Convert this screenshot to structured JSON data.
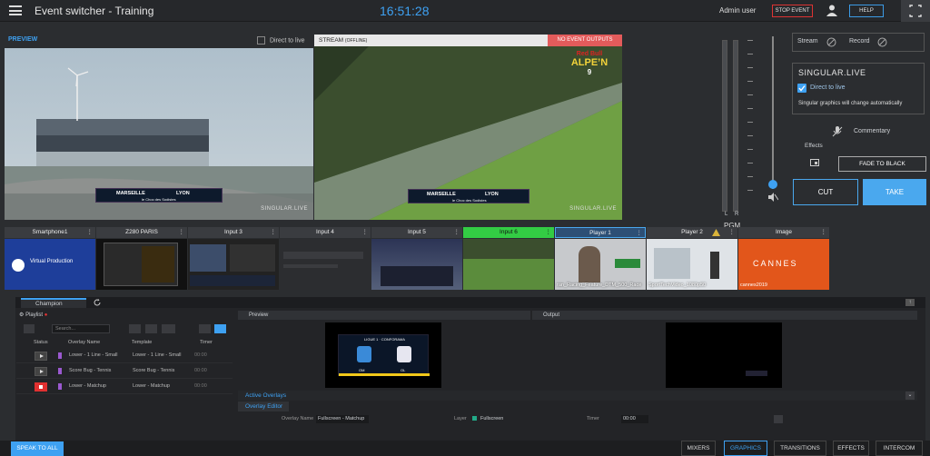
{
  "header": {
    "title": "Event switcher - Training",
    "clock": "16:51:28",
    "user": "Admin user",
    "stop_event": "STOP EVENT",
    "help": "HELP"
  },
  "preview": {
    "label": "PREVIEW",
    "direct_to_live": "Direct to live",
    "score_home": "MARSEILLE",
    "score_away": "LYON",
    "score_sub": "le Choc des Sodistes",
    "watermark": "SINGULAR.LIVE"
  },
  "stream": {
    "label": "STREAM",
    "state": "(OFFLINE)",
    "no_outputs": "NO EVENT OUTPUTS",
    "score_home": "MARSEILLE",
    "score_away": "LYON",
    "score_sub": "le Choc des Sodistes",
    "watermark": "SINGULAR.LIVE",
    "logo_top": "Red Bull",
    "logo_bottom": "ALPE’N",
    "logo_num": "9"
  },
  "audio": {
    "left": "L",
    "right": "R",
    "pgm": "PGM",
    "level": 0.9
  },
  "right_panel": {
    "stream": "Stream",
    "record": "Record",
    "singular_title": "SINGULAR.LIVE",
    "singular_direct": "Direct to live",
    "singular_note": "Singular graphics will change automatically",
    "commentary": "Commentary",
    "effects": "Effects",
    "fade_black": "FADE TO BLACK",
    "cut": "CUT",
    "take": "TAKE"
  },
  "sources": [
    {
      "name": "Smartphone1",
      "caption": "",
      "inner": "Virtual Production"
    },
    {
      "name": "Z280 PARIS",
      "caption": "",
      "inner": ""
    },
    {
      "name": "Input 3",
      "caption": "",
      "inner": ""
    },
    {
      "name": "Input 4",
      "caption": "",
      "inner": ""
    },
    {
      "name": "Input 5",
      "caption": "",
      "inner": ""
    },
    {
      "name": "Input 6",
      "caption": "",
      "inner": ""
    },
    {
      "name": "Player 1",
      "caption": "ran_Racing_Feature_DTM_500_Race",
      "inner": ""
    },
    {
      "name": "Player 2",
      "caption": "SportTechVideo_1080p50",
      "inner": ""
    },
    {
      "name": "Image",
      "caption": "cannes2019",
      "inner": "CANNES"
    }
  ],
  "control": {
    "tab": "Champion",
    "playlist": "Playlist",
    "search_placeholder": "Search...",
    "columns": {
      "status": "Status",
      "name": "Overlay Name",
      "template": "Template",
      "timer": "Timer"
    },
    "rows": [
      {
        "name": "Lower - 1 Line - Small",
        "template": "Lower - 1 Line - Small",
        "timer": "00:00",
        "state": "play"
      },
      {
        "name": "Score Bug - Tennis",
        "template": "Score Bug - Tennis",
        "timer": "00:00",
        "state": "play"
      },
      {
        "name": "Lower - Matchup",
        "template": "Lower - Matchup",
        "timer": "00:00",
        "state": "stop"
      }
    ],
    "preview": "Preview",
    "output": "Output",
    "active_overlays": "Active Overlays",
    "overlay_editor": "Overlay Editor",
    "overlay_name_label": "Overlay Name",
    "overlay_name_value": "Fullscreen - Matchup",
    "layer_label": "Layer",
    "layer_value": "Fullscreen",
    "timer_label": "Timer",
    "timer_value": "00:00",
    "ovl_title": "LIGUE 1 · CONFORAMA",
    "ovl_home": "OM",
    "ovl_away": "OL"
  },
  "bottom": {
    "speak": "SPEAK TO ALL",
    "tabs": [
      "MIXERS",
      "GRAPHICS",
      "TRANSITIONS",
      "EFFECTS",
      "INTERCOM"
    ]
  },
  "colors": {
    "accent": "#3ea1f2",
    "take": "#4aa8ee",
    "alert": "#e35b5b",
    "live_green": "#33cc44"
  }
}
